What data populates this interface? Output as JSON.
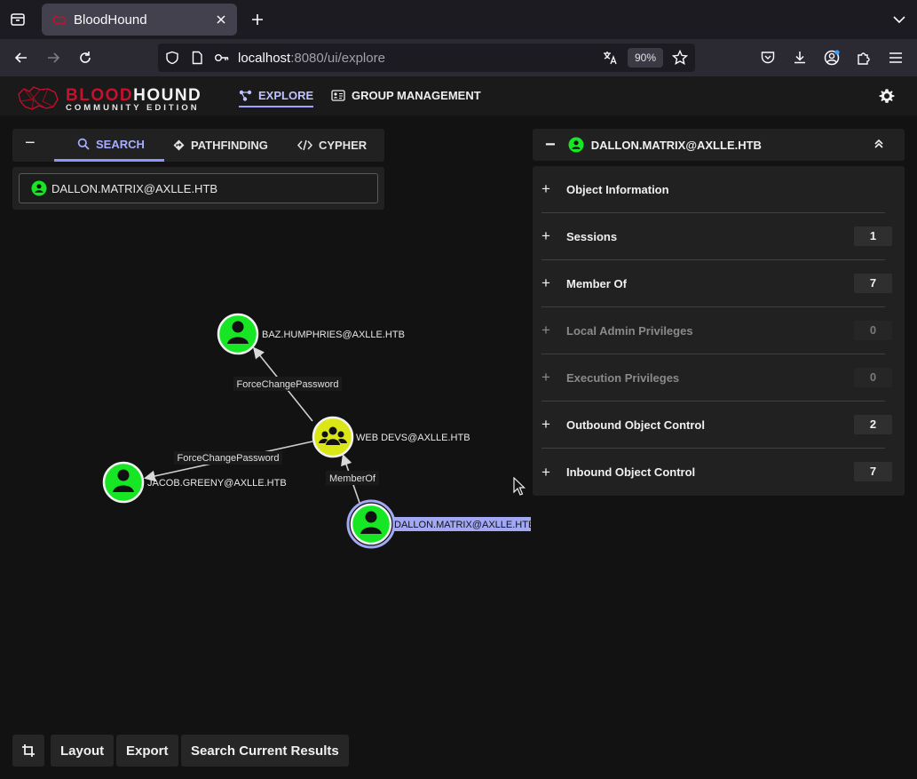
{
  "browser": {
    "tab_title": "BloodHound",
    "url_host": "localhost",
    "url_rest": ":8080/ui/explore",
    "zoom": "90%"
  },
  "app": {
    "logo_word1": "BLOOD",
    "logo_word2": "HOUND",
    "logo_sub": "COMMUNITY EDITION",
    "nav": [
      {
        "label": "EXPLORE",
        "active": true
      },
      {
        "label": "GROUP MANAGEMENT",
        "active": false
      }
    ]
  },
  "search_panel": {
    "collapse": "−",
    "tabs": [
      "SEARCH",
      "PATHFINDING",
      "CYPHER"
    ],
    "value": "DALLON.MATRIX@AXLLE.HTB"
  },
  "graph": {
    "nodes": [
      {
        "label": "BAZ.HUMPHRIES@AXLLE.HTB",
        "kind": "user"
      },
      {
        "label": "WEB DEVS@AXLLE.HTB",
        "kind": "group"
      },
      {
        "label": "JACOB.GREENY@AXLLE.HTB",
        "kind": "user"
      },
      {
        "label": "DALLON.MATRIX@AXLLE.HTB",
        "kind": "user"
      }
    ],
    "edges": [
      {
        "label": "ForceChangePassword"
      },
      {
        "label": "ForceChangePassword"
      },
      {
        "label": "MemberOf"
      }
    ],
    "colors": {
      "user": "#17e625",
      "group": "#dbe617",
      "selected_label_bg": "#a3a8f5"
    }
  },
  "entity_panel": {
    "title": "DALLON.MATRIX@AXLLE.HTB",
    "collapse": "−",
    "rows": [
      {
        "label": "Object Information",
        "count": "",
        "disabled": false
      },
      {
        "label": "Sessions",
        "count": "1",
        "disabled": false
      },
      {
        "label": "Member Of",
        "count": "7",
        "disabled": false
      },
      {
        "label": "Local Admin Privileges",
        "count": "0",
        "disabled": true
      },
      {
        "label": "Execution Privileges",
        "count": "0",
        "disabled": true
      },
      {
        "label": "Outbound Object Control",
        "count": "2",
        "disabled": false
      },
      {
        "label": "Inbound Object Control",
        "count": "7",
        "disabled": false
      }
    ]
  },
  "bottom_bar": {
    "layout": "Layout",
    "export": "Export",
    "search_current": "Search Current Results"
  }
}
